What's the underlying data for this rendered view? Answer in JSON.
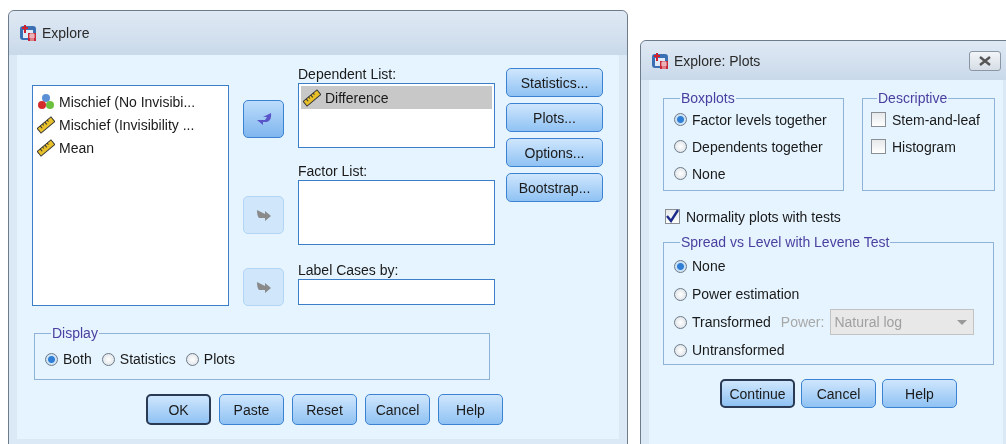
{
  "explore": {
    "title": "Explore",
    "source_variables": [
      {
        "label": "Mischief (No Invisibi...",
        "kind": "nominal",
        "selected": false
      },
      {
        "label": "Mischief (Invisibility ...",
        "kind": "scale",
        "selected": false
      },
      {
        "label": "Mean",
        "kind": "scale",
        "selected": false
      }
    ],
    "move_buttons": [
      {
        "kind": "left",
        "disabled": false
      },
      {
        "kind": "right",
        "disabled": true
      },
      {
        "kind": "right",
        "disabled": true
      }
    ],
    "dependent_list": {
      "label": "Dependent List:",
      "items": [
        {
          "label": "Difference",
          "kind": "scale",
          "selected": true
        }
      ]
    },
    "factor_list": {
      "label": "Factor List:"
    },
    "label_cases": {
      "label": "Label Cases by:"
    },
    "side_buttons": [
      "Statistics...",
      "Plots...",
      "Options...",
      "Bootstrap..."
    ],
    "display": {
      "title": "Display",
      "options": [
        {
          "label": "Both",
          "selected": true
        },
        {
          "label": "Statistics",
          "selected": false
        },
        {
          "label": "Plots",
          "selected": false
        }
      ]
    },
    "buttons": [
      {
        "label": "OK",
        "default": true
      },
      {
        "label": "Paste",
        "default": false
      },
      {
        "label": "Reset",
        "default": false
      },
      {
        "label": "Cancel",
        "default": false
      },
      {
        "label": "Help",
        "default": false
      }
    ]
  },
  "plots": {
    "title": "Explore: Plots",
    "boxplots": {
      "title": "Boxplots",
      "options": [
        {
          "label": "Factor levels together",
          "selected": true
        },
        {
          "label": "Dependents together",
          "selected": false
        },
        {
          "label": "None",
          "selected": false
        }
      ]
    },
    "descriptive": {
      "title": "Descriptive",
      "options": [
        {
          "label": "Stem-and-leaf",
          "checked": false
        },
        {
          "label": "Histogram",
          "checked": false
        }
      ]
    },
    "normality": {
      "label": "Normality plots with tests",
      "checked": true
    },
    "spread": {
      "title": "Spread vs Level with Levene Test",
      "options": [
        {
          "label": "None",
          "selected": true
        },
        {
          "label": "Power estimation",
          "selected": false
        },
        {
          "label": "Transformed",
          "selected": false,
          "power": {
            "label": "Power:",
            "value": "Natural log",
            "disabled": true
          }
        },
        {
          "label": "Untransformed",
          "selected": false
        }
      ]
    },
    "buttons": [
      {
        "label": "Continue",
        "default": true
      },
      {
        "label": "Cancel",
        "default": false
      },
      {
        "label": "Help",
        "default": false
      }
    ]
  }
}
